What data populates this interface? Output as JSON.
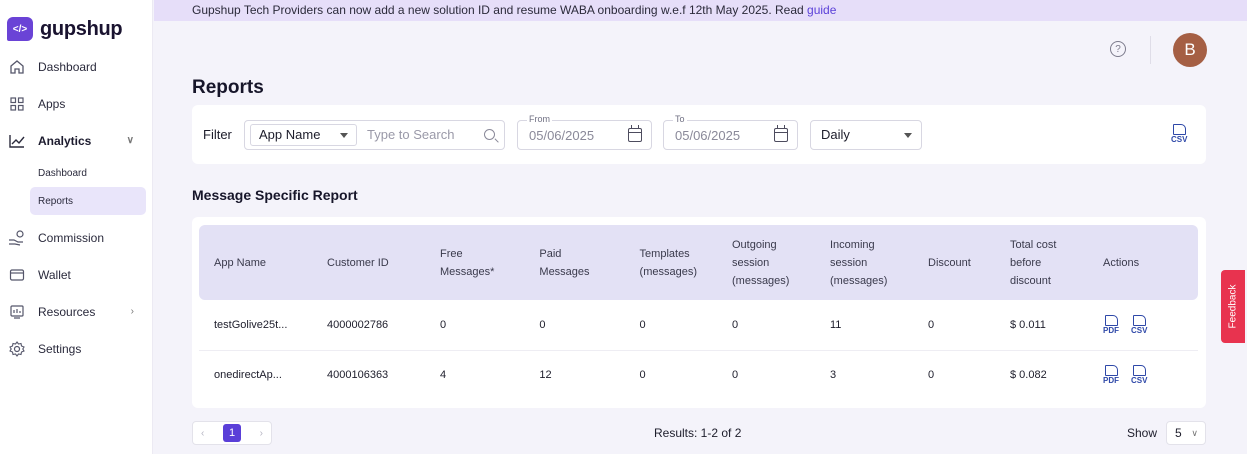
{
  "brand": {
    "name": "gupshup",
    "mark": "</>"
  },
  "banner": {
    "text": "Gupshup Tech Providers can now add a new solution ID and resume WABA onboarding w.e.f 12th May 2025. Read ",
    "link": "guide"
  },
  "sidebar": {
    "items": [
      {
        "label": "Dashboard",
        "icon": "home-icon"
      },
      {
        "label": "Apps",
        "icon": "grid-icon"
      },
      {
        "label": "Analytics",
        "icon": "chart-line-icon",
        "expanded": true
      },
      {
        "label": "Commission",
        "icon": "hand-coin-icon"
      },
      {
        "label": "Wallet",
        "icon": "wallet-icon"
      },
      {
        "label": "Resources",
        "icon": "resources-icon"
      },
      {
        "label": "Settings",
        "icon": "gear-icon"
      }
    ],
    "analytics_sub": [
      {
        "label": "Dashboard"
      },
      {
        "label": "Reports",
        "active": true
      }
    ]
  },
  "header": {
    "help": "?",
    "avatar_initial": "B"
  },
  "page": {
    "title": "Reports",
    "section_title": "Message Specific Report"
  },
  "filter": {
    "label": "Filter",
    "app_select": "App Name",
    "search_placeholder": "Type to Search",
    "from_label": "From",
    "from_value": "05/06/2025",
    "to_label": "To",
    "to_value": "05/06/2025",
    "period": "Daily",
    "export_label": "CSV"
  },
  "table": {
    "headers": [
      "App Name",
      "Customer ID",
      "Free Messages*",
      "Paid Messages",
      "Templates (messages)",
      "Outgoing session (messages)",
      "Incoming session (messages)",
      "Discount",
      "Total cost before discount",
      "Actions"
    ],
    "rows": [
      [
        "testGolive25t...",
        "4000002786",
        "0",
        "0",
        "0",
        "0",
        "11",
        "0",
        "$ 0.011"
      ],
      [
        "onedirectAp...",
        "4000106363",
        "4",
        "12",
        "0",
        "0",
        "3",
        "0",
        "$ 0.082"
      ]
    ],
    "action_pdf": "PDF",
    "action_csv": "CSV"
  },
  "pagination": {
    "prev": "‹",
    "current": "1",
    "next": "›",
    "results": "Results: 1-2 of 2",
    "show_label": "Show",
    "page_size": "5"
  },
  "feedback": "Feedback",
  "colors": {
    "accent": "#5a3fd8",
    "banner_bg": "#e6def9",
    "feedback": "#e8334f",
    "avatar": "#a55f44"
  }
}
